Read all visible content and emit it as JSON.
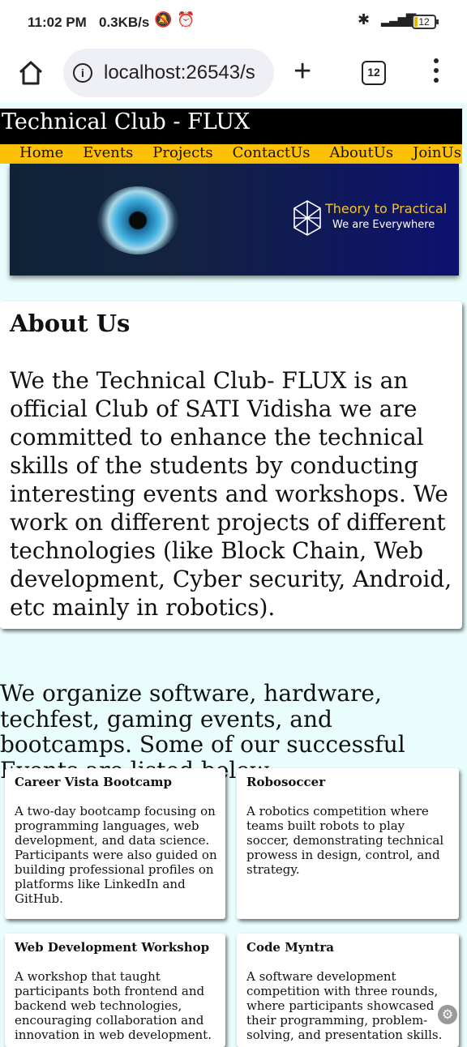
{
  "status_bar": {
    "time": "11:02 PM",
    "network_speed": "0.3KB/s",
    "battery_level": "12",
    "icons": [
      "mute-icon",
      "alarm-icon",
      "bluetooth-icon",
      "signal-icon",
      "battery-icon"
    ]
  },
  "browser": {
    "url": "localhost:26543/s",
    "tab_count": "12",
    "icons": [
      "home-icon",
      "info-icon",
      "plus-icon",
      "tab-switcher-icon",
      "menu-dots-icon"
    ]
  },
  "site": {
    "title": "Technical Club - FLUX",
    "nav": [
      "Home",
      "Events",
      "Projects",
      "ContactUs",
      "AboutUs",
      "JoinUs"
    ],
    "banner": {
      "title": "Theory to Practical",
      "subtitle": "We are Everywhere"
    },
    "about": {
      "heading": "About Us",
      "text": "We the Technical Club- FLUX is an official Club of SATI Vidisha we are committed to enhance the technical skills of the students by conducting interesting events and workshops. We work on different projects of different technologies (like Block Chain, Web development, Cyber security, Android, etc mainly in robotics)."
    },
    "events_intro": "We organize software, hardware, techfest, gaming events, and bootcamps. Some of our successful Events are listed below",
    "events": [
      {
        "title": "Career Vista Bootcamp",
        "description": "A two-day bootcamp focusing on programming languages, web development, and data science. Participants were also guided on building professional profiles on platforms like LinkedIn and GitHub."
      },
      {
        "title": "Robosoccer",
        "description": "A robotics competition where teams built robots to play soccer, demonstrating technical prowess in design, control, and strategy."
      },
      {
        "title": "Web Development Workshop",
        "description": "A workshop that taught participants both frontend and backend web technologies, encouraging collaboration and innovation in web development."
      },
      {
        "title": "Code Myntra",
        "description": "A software development competition with three rounds, where participants showcased their programming, problem-solving, and presentation skills."
      }
    ]
  },
  "colors": {
    "nav_bg": "#ffc107",
    "title_bg": "#000000",
    "page_bg": "#eafdfd",
    "banner_accent": "#f2c230"
  }
}
